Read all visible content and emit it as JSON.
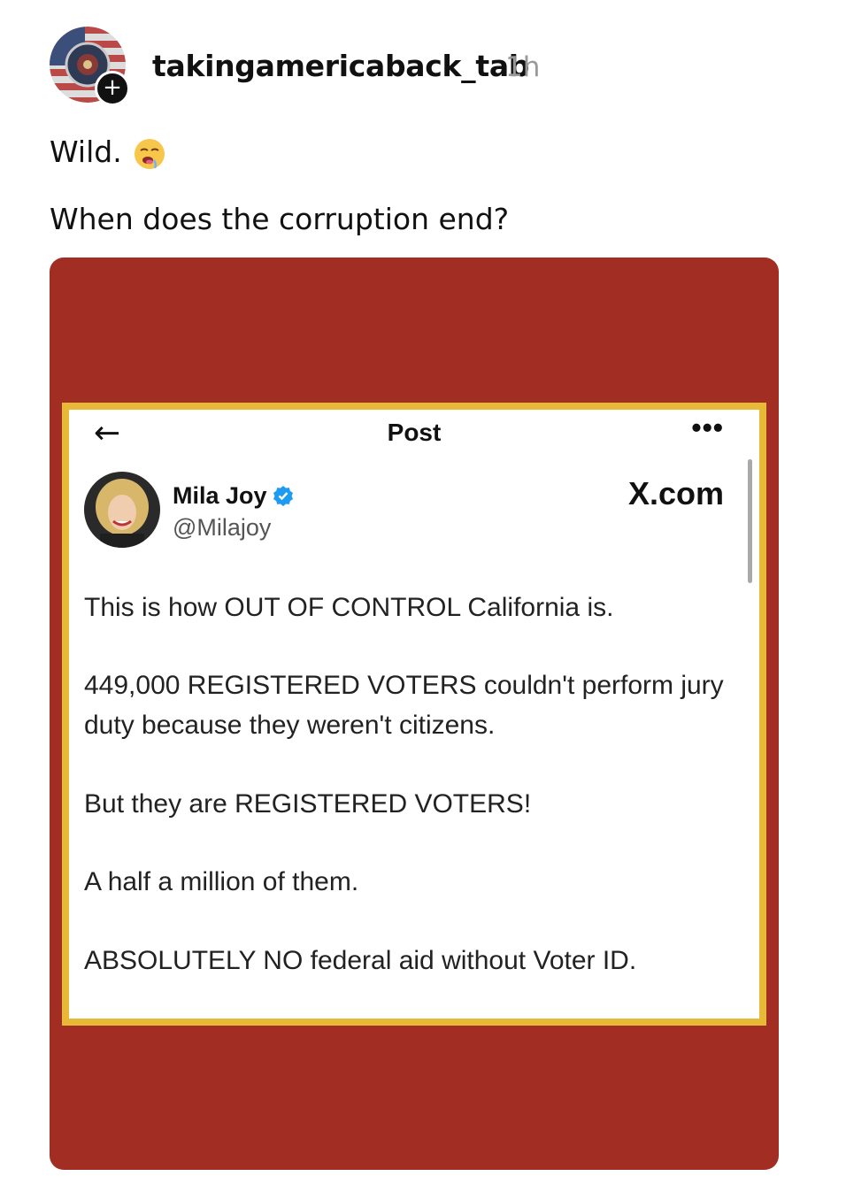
{
  "post": {
    "username": "takingamericaback_tab",
    "timestamp": "1h",
    "follow_glyph": "+",
    "caption_line1": "Wild.",
    "caption_emoji": "drooling-face-emoji",
    "caption_line2": "When does the corruption end?"
  },
  "media": {
    "background_color": "#a12d23",
    "frame_color": "#e8b837",
    "tweet": {
      "header_title": "Post",
      "back_icon": "arrow-left-icon",
      "more_icon": "more-dots-icon",
      "author_name": "Mila Joy",
      "author_handle": "@Milajoy",
      "source_label": "X.com",
      "paragraphs": [
        "This is how OUT OF CONTROL California is.",
        "449,000 REGISTERED VOTERS couldn't perform jury duty because they weren't citizens.",
        "But they are REGISTERED VOTERS!",
        "A half a million of them.",
        "ABSOLUTELY NO federal aid without Voter ID."
      ]
    }
  }
}
